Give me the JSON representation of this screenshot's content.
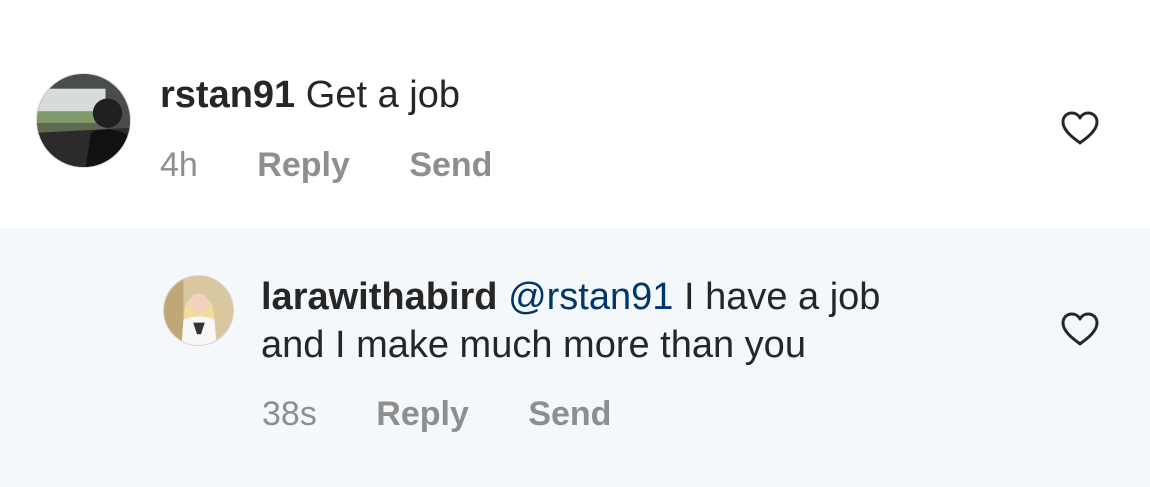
{
  "comments": [
    {
      "username": "rstan91",
      "mention": "",
      "text": " Get a job",
      "time": "4h",
      "reply_label": "Reply",
      "send_label": "Send"
    },
    {
      "username": "larawithabird",
      "mention": "@rstan91",
      "text_line1": " I have a job",
      "text_line2": "and I make much more than you",
      "time": "38s",
      "reply_label": "Reply",
      "send_label": "Send"
    }
  ],
  "icons": {
    "like": "heart-outline-icon"
  },
  "colors": {
    "mention": "#00376b",
    "meta": "#8e8e8e",
    "reply_background": "#f4f8fb"
  }
}
